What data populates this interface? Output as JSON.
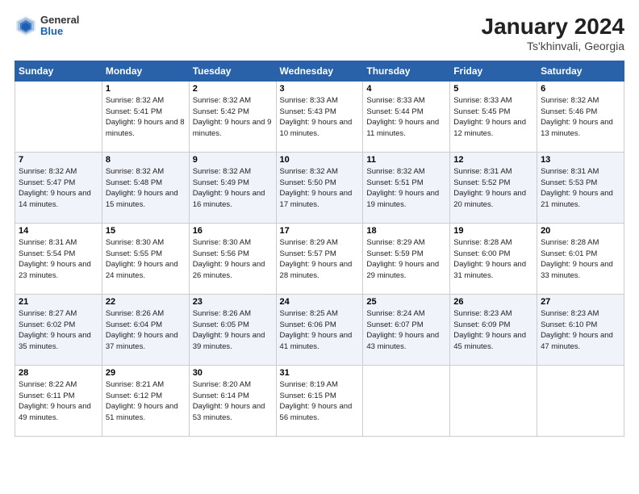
{
  "header": {
    "logo_general": "General",
    "logo_blue": "Blue",
    "month_title": "January 2024",
    "subtitle": "Ts'khinvali, Georgia"
  },
  "days_of_week": [
    "Sunday",
    "Monday",
    "Tuesday",
    "Wednesday",
    "Thursday",
    "Friday",
    "Saturday"
  ],
  "weeks": [
    [
      {
        "day": "",
        "sunrise": "",
        "sunset": "",
        "daylight": ""
      },
      {
        "day": "1",
        "sunrise": "Sunrise: 8:32 AM",
        "sunset": "Sunset: 5:41 PM",
        "daylight": "Daylight: 9 hours and 8 minutes."
      },
      {
        "day": "2",
        "sunrise": "Sunrise: 8:32 AM",
        "sunset": "Sunset: 5:42 PM",
        "daylight": "Daylight: 9 hours and 9 minutes."
      },
      {
        "day": "3",
        "sunrise": "Sunrise: 8:33 AM",
        "sunset": "Sunset: 5:43 PM",
        "daylight": "Daylight: 9 hours and 10 minutes."
      },
      {
        "day": "4",
        "sunrise": "Sunrise: 8:33 AM",
        "sunset": "Sunset: 5:44 PM",
        "daylight": "Daylight: 9 hours and 11 minutes."
      },
      {
        "day": "5",
        "sunrise": "Sunrise: 8:33 AM",
        "sunset": "Sunset: 5:45 PM",
        "daylight": "Daylight: 9 hours and 12 minutes."
      },
      {
        "day": "6",
        "sunrise": "Sunrise: 8:32 AM",
        "sunset": "Sunset: 5:46 PM",
        "daylight": "Daylight: 9 hours and 13 minutes."
      }
    ],
    [
      {
        "day": "7",
        "sunrise": "Sunrise: 8:32 AM",
        "sunset": "Sunset: 5:47 PM",
        "daylight": "Daylight: 9 hours and 14 minutes."
      },
      {
        "day": "8",
        "sunrise": "Sunrise: 8:32 AM",
        "sunset": "Sunset: 5:48 PM",
        "daylight": "Daylight: 9 hours and 15 minutes."
      },
      {
        "day": "9",
        "sunrise": "Sunrise: 8:32 AM",
        "sunset": "Sunset: 5:49 PM",
        "daylight": "Daylight: 9 hours and 16 minutes."
      },
      {
        "day": "10",
        "sunrise": "Sunrise: 8:32 AM",
        "sunset": "Sunset: 5:50 PM",
        "daylight": "Daylight: 9 hours and 17 minutes."
      },
      {
        "day": "11",
        "sunrise": "Sunrise: 8:32 AM",
        "sunset": "Sunset: 5:51 PM",
        "daylight": "Daylight: 9 hours and 19 minutes."
      },
      {
        "day": "12",
        "sunrise": "Sunrise: 8:31 AM",
        "sunset": "Sunset: 5:52 PM",
        "daylight": "Daylight: 9 hours and 20 minutes."
      },
      {
        "day": "13",
        "sunrise": "Sunrise: 8:31 AM",
        "sunset": "Sunset: 5:53 PM",
        "daylight": "Daylight: 9 hours and 21 minutes."
      }
    ],
    [
      {
        "day": "14",
        "sunrise": "Sunrise: 8:31 AM",
        "sunset": "Sunset: 5:54 PM",
        "daylight": "Daylight: 9 hours and 23 minutes."
      },
      {
        "day": "15",
        "sunrise": "Sunrise: 8:30 AM",
        "sunset": "Sunset: 5:55 PM",
        "daylight": "Daylight: 9 hours and 24 minutes."
      },
      {
        "day": "16",
        "sunrise": "Sunrise: 8:30 AM",
        "sunset": "Sunset: 5:56 PM",
        "daylight": "Daylight: 9 hours and 26 minutes."
      },
      {
        "day": "17",
        "sunrise": "Sunrise: 8:29 AM",
        "sunset": "Sunset: 5:57 PM",
        "daylight": "Daylight: 9 hours and 28 minutes."
      },
      {
        "day": "18",
        "sunrise": "Sunrise: 8:29 AM",
        "sunset": "Sunset: 5:59 PM",
        "daylight": "Daylight: 9 hours and 29 minutes."
      },
      {
        "day": "19",
        "sunrise": "Sunrise: 8:28 AM",
        "sunset": "Sunset: 6:00 PM",
        "daylight": "Daylight: 9 hours and 31 minutes."
      },
      {
        "day": "20",
        "sunrise": "Sunrise: 8:28 AM",
        "sunset": "Sunset: 6:01 PM",
        "daylight": "Daylight: 9 hours and 33 minutes."
      }
    ],
    [
      {
        "day": "21",
        "sunrise": "Sunrise: 8:27 AM",
        "sunset": "Sunset: 6:02 PM",
        "daylight": "Daylight: 9 hours and 35 minutes."
      },
      {
        "day": "22",
        "sunrise": "Sunrise: 8:26 AM",
        "sunset": "Sunset: 6:04 PM",
        "daylight": "Daylight: 9 hours and 37 minutes."
      },
      {
        "day": "23",
        "sunrise": "Sunrise: 8:26 AM",
        "sunset": "Sunset: 6:05 PM",
        "daylight": "Daylight: 9 hours and 39 minutes."
      },
      {
        "day": "24",
        "sunrise": "Sunrise: 8:25 AM",
        "sunset": "Sunset: 6:06 PM",
        "daylight": "Daylight: 9 hours and 41 minutes."
      },
      {
        "day": "25",
        "sunrise": "Sunrise: 8:24 AM",
        "sunset": "Sunset: 6:07 PM",
        "daylight": "Daylight: 9 hours and 43 minutes."
      },
      {
        "day": "26",
        "sunrise": "Sunrise: 8:23 AM",
        "sunset": "Sunset: 6:09 PM",
        "daylight": "Daylight: 9 hours and 45 minutes."
      },
      {
        "day": "27",
        "sunrise": "Sunrise: 8:23 AM",
        "sunset": "Sunset: 6:10 PM",
        "daylight": "Daylight: 9 hours and 47 minutes."
      }
    ],
    [
      {
        "day": "28",
        "sunrise": "Sunrise: 8:22 AM",
        "sunset": "Sunset: 6:11 PM",
        "daylight": "Daylight: 9 hours and 49 minutes."
      },
      {
        "day": "29",
        "sunrise": "Sunrise: 8:21 AM",
        "sunset": "Sunset: 6:12 PM",
        "daylight": "Daylight: 9 hours and 51 minutes."
      },
      {
        "day": "30",
        "sunrise": "Sunrise: 8:20 AM",
        "sunset": "Sunset: 6:14 PM",
        "daylight": "Daylight: 9 hours and 53 minutes."
      },
      {
        "day": "31",
        "sunrise": "Sunrise: 8:19 AM",
        "sunset": "Sunset: 6:15 PM",
        "daylight": "Daylight: 9 hours and 56 minutes."
      },
      {
        "day": "",
        "sunrise": "",
        "sunset": "",
        "daylight": ""
      },
      {
        "day": "",
        "sunrise": "",
        "sunset": "",
        "daylight": ""
      },
      {
        "day": "",
        "sunrise": "",
        "sunset": "",
        "daylight": ""
      }
    ]
  ]
}
